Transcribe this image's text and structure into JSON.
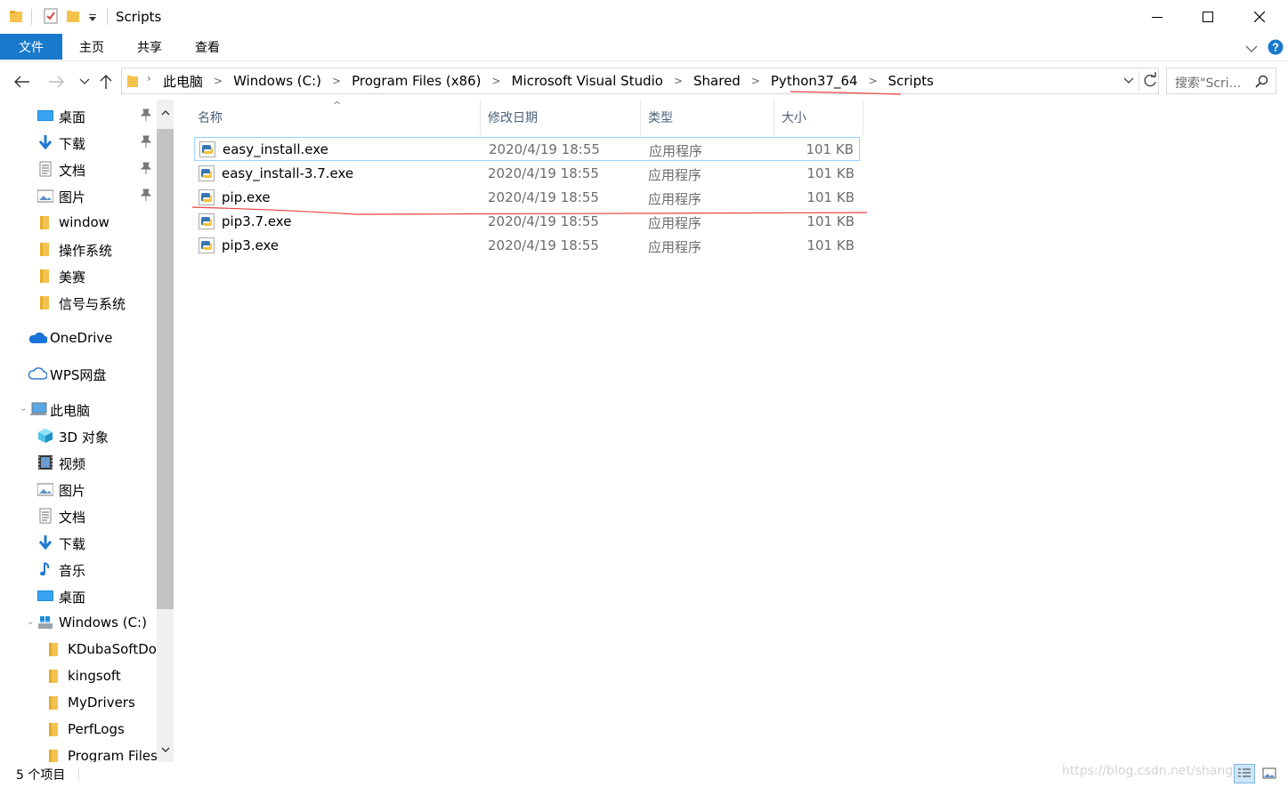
{
  "window": {
    "title": "Scripts"
  },
  "ribbon": {
    "tabs": [
      "文件",
      "主页",
      "共享",
      "查看"
    ]
  },
  "address": {
    "crumbs": [
      "此电脑",
      "Windows (C:)",
      "Program Files (x86)",
      "Microsoft Visual Studio",
      "Shared",
      "Python37_64",
      "Scripts"
    ]
  },
  "search": {
    "placeholder": "搜索\"Scri..."
  },
  "nav": {
    "quick_access": [
      {
        "label": "桌面",
        "icon": "desktop-icon",
        "pinned": true
      },
      {
        "label": "下载",
        "icon": "download-icon",
        "pinned": true
      },
      {
        "label": "文档",
        "icon": "document-icon",
        "pinned": true
      },
      {
        "label": "图片",
        "icon": "picture-icon",
        "pinned": true
      },
      {
        "label": "window",
        "icon": "folder-icon",
        "pinned": false
      },
      {
        "label": "操作系统",
        "icon": "folder-icon",
        "pinned": false
      },
      {
        "label": "美赛",
        "icon": "folder-icon",
        "pinned": false
      },
      {
        "label": "信号与系统",
        "icon": "folder-icon",
        "pinned": false
      }
    ],
    "onedrive": "OneDrive",
    "wps": "WPS网盘",
    "this_pc": "此电脑",
    "pc_items": [
      {
        "label": "3D 对象",
        "icon": "3d-objects-icon"
      },
      {
        "label": "视频",
        "icon": "video-icon"
      },
      {
        "label": "图片",
        "icon": "picture-icon"
      },
      {
        "label": "文档",
        "icon": "document-icon"
      },
      {
        "label": "下载",
        "icon": "download-icon"
      },
      {
        "label": "音乐",
        "icon": "music-icon"
      },
      {
        "label": "桌面",
        "icon": "desktop-icon"
      }
    ],
    "drive": "Windows (C:)",
    "drive_folders": [
      "KDubaSoftDo",
      "kingsoft",
      "MyDrivers",
      "PerfLogs",
      "Program Files"
    ]
  },
  "columns": {
    "name": "名称",
    "modified": "修改日期",
    "type": "类型",
    "size": "大小"
  },
  "files": [
    {
      "name": "easy_install.exe",
      "modified": "2020/4/19 18:55",
      "type": "应用程序",
      "size": "101 KB"
    },
    {
      "name": "easy_install-3.7.exe",
      "modified": "2020/4/19 18:55",
      "type": "应用程序",
      "size": "101 KB"
    },
    {
      "name": "pip.exe",
      "modified": "2020/4/19 18:55",
      "type": "应用程序",
      "size": "101 KB"
    },
    {
      "name": "pip3.7.exe",
      "modified": "2020/4/19 18:55",
      "type": "应用程序",
      "size": "101 KB"
    },
    {
      "name": "pip3.exe",
      "modified": "2020/4/19 18:55",
      "type": "应用程序",
      "size": "101 KB"
    }
  ],
  "status": {
    "count": "5 个项目",
    "watermark": "https://blog.csdn.net/shang"
  },
  "colors": {
    "accent": "#1979ca",
    "folder": "#f4c24d",
    "selection_border": "#99d1ff",
    "annotation": "#e8403f"
  }
}
